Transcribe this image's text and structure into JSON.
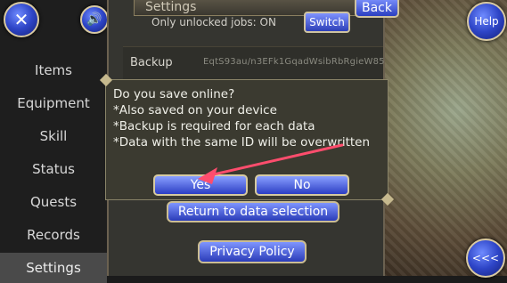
{
  "header": {
    "title": "Settings",
    "back_label": "Back",
    "help_label": "Help"
  },
  "sidebar": {
    "items": [
      {
        "label": "Items"
      },
      {
        "label": "Equipment"
      },
      {
        "label": "Skill"
      },
      {
        "label": "Status"
      },
      {
        "label": "Quests"
      },
      {
        "label": "Records"
      },
      {
        "label": "Settings"
      }
    ]
  },
  "settings": {
    "unlocked_jobs_label": "Only unlocked jobs: ON",
    "switch_label": "Switch",
    "backup_label": "Backup",
    "backup_id": "EqtS93au/n3EFk1GqadWsibRbRgieW85"
  },
  "underlying_buttons": {
    "return_label": "Return to data selection",
    "privacy_label": "Privacy Policy"
  },
  "dialog": {
    "lines": [
      "Do you save online?",
      "*Also saved on your device",
      "*Backup is required for each data",
      "*Data with the same ID will be overwritten"
    ],
    "yes_label": "Yes",
    "no_label": "No"
  },
  "collapse_label": "<<<",
  "icons": {
    "close": "close-icon",
    "sound": "speaker-icon",
    "arrow": "annotation-arrow"
  },
  "colors": {
    "accent": "#2c3ec3",
    "annotation": "#ff4d6d"
  }
}
